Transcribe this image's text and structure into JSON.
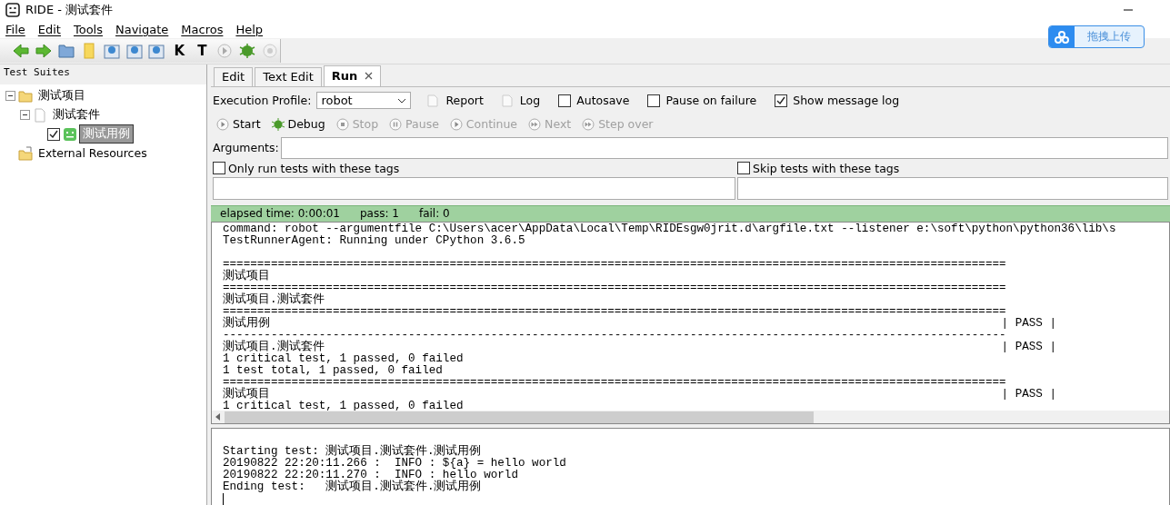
{
  "window": {
    "title": "RIDE - 测试套件"
  },
  "menu": [
    "File",
    "Edit",
    "Tools",
    "Navigate",
    "Macros",
    "Help"
  ],
  "upload_button": {
    "label": "拖拽上传"
  },
  "toolbar": [
    {
      "kind": "back"
    },
    {
      "kind": "forward"
    },
    {
      "kind": "open"
    },
    {
      "kind": "note"
    },
    {
      "kind": "save"
    },
    {
      "kind": "save"
    },
    {
      "kind": "save"
    },
    {
      "kind": "letter",
      "text": "K"
    },
    {
      "kind": "letter",
      "text": "T"
    },
    {
      "kind": "play"
    },
    {
      "kind": "bug"
    },
    {
      "kind": "stop"
    }
  ],
  "sidebar": {
    "title": "Test Suites",
    "tree": [
      {
        "label": "测试项目",
        "kind": "folder",
        "expanded": true,
        "children": [
          {
            "label": "测试套件",
            "kind": "file",
            "expanded": true,
            "children": [
              {
                "label": "测试用例",
                "kind": "test",
                "checked": true,
                "selected": true
              }
            ]
          }
        ]
      },
      {
        "label": "External Resources",
        "kind": "resources"
      }
    ]
  },
  "tabs": [
    {
      "label": "Edit",
      "selected": false
    },
    {
      "label": "Text Edit",
      "selected": false
    },
    {
      "label": "Run",
      "selected": true,
      "closable": true
    }
  ],
  "execution_profile": {
    "label": "Execution Profile:",
    "value": "robot"
  },
  "report_links": [
    "Report",
    "Log"
  ],
  "options": [
    {
      "label": "Autosave",
      "checked": false
    },
    {
      "label": "Pause on failure",
      "checked": false
    },
    {
      "label": "Show message log",
      "checked": true
    }
  ],
  "run_buttons": [
    {
      "label": "Start",
      "kind": "play",
      "disabled": false
    },
    {
      "label": "Debug",
      "kind": "bug",
      "disabled": false
    },
    {
      "label": "Stop",
      "kind": "stop",
      "disabled": true
    },
    {
      "label": "Pause",
      "kind": "pause",
      "disabled": true
    },
    {
      "label": "Continue",
      "kind": "play",
      "disabled": true
    },
    {
      "label": "Next",
      "kind": "next",
      "disabled": true
    },
    {
      "label": "Step over",
      "kind": "next",
      "disabled": true
    }
  ],
  "arguments": {
    "label": "Arguments:"
  },
  "tag_filters": [
    {
      "label": "Only run tests with these tags",
      "checked": false
    },
    {
      "label": "Skip tests with these tags",
      "checked": false
    }
  ],
  "status_bar": [
    "elapsed time: 0:00:01",
    "pass: 1",
    "fail: 0"
  ],
  "output": [
    {
      "kind": "text",
      "text": "command: robot --argumentfile C:\\Users\\acer\\AppData\\Local\\Temp\\RIDEsgw0jrit.d\\argfile.txt --listener e:\\soft\\python\\python36\\lib\\s"
    },
    {
      "kind": "text",
      "text": "TestRunnerAgent: Running under CPython 3.6.5"
    },
    {
      "kind": "blank"
    },
    {
      "kind": "rule",
      "text": "=================================================================================================================="
    },
    {
      "kind": "text",
      "text": "测试项目"
    },
    {
      "kind": "rule",
      "text": "=================================================================================================================="
    },
    {
      "kind": "text",
      "text": "测试项目.测试套件"
    },
    {
      "kind": "rule",
      "text": "=================================================================================================================="
    },
    {
      "kind": "result",
      "text": "测试用例",
      "status": "| PASS |"
    },
    {
      "kind": "rule",
      "text": "------------------------------------------------------------------------------------------------------------------"
    },
    {
      "kind": "result",
      "text": "测试项目.测试套件",
      "status": "| PASS |"
    },
    {
      "kind": "text",
      "text": "1 critical test, 1 passed, 0 failed"
    },
    {
      "kind": "text",
      "text": "1 test total, 1 passed, 0 failed"
    },
    {
      "kind": "rule",
      "text": "=================================================================================================================="
    },
    {
      "kind": "result",
      "text": "测试项目",
      "status": "| PASS |"
    },
    {
      "kind": "text",
      "text": "1 critical test, 1 passed, 0 failed"
    }
  ],
  "message_log": [
    "Starting test: 测试项目.测试套件.测试用例",
    "20190822 22:20:11.266 :  INFO : ${a} = hello world",
    "20190822 22:20:11.270 :  INFO : hello world",
    "Ending test:   测试项目.测试套件.测试用例"
  ]
}
